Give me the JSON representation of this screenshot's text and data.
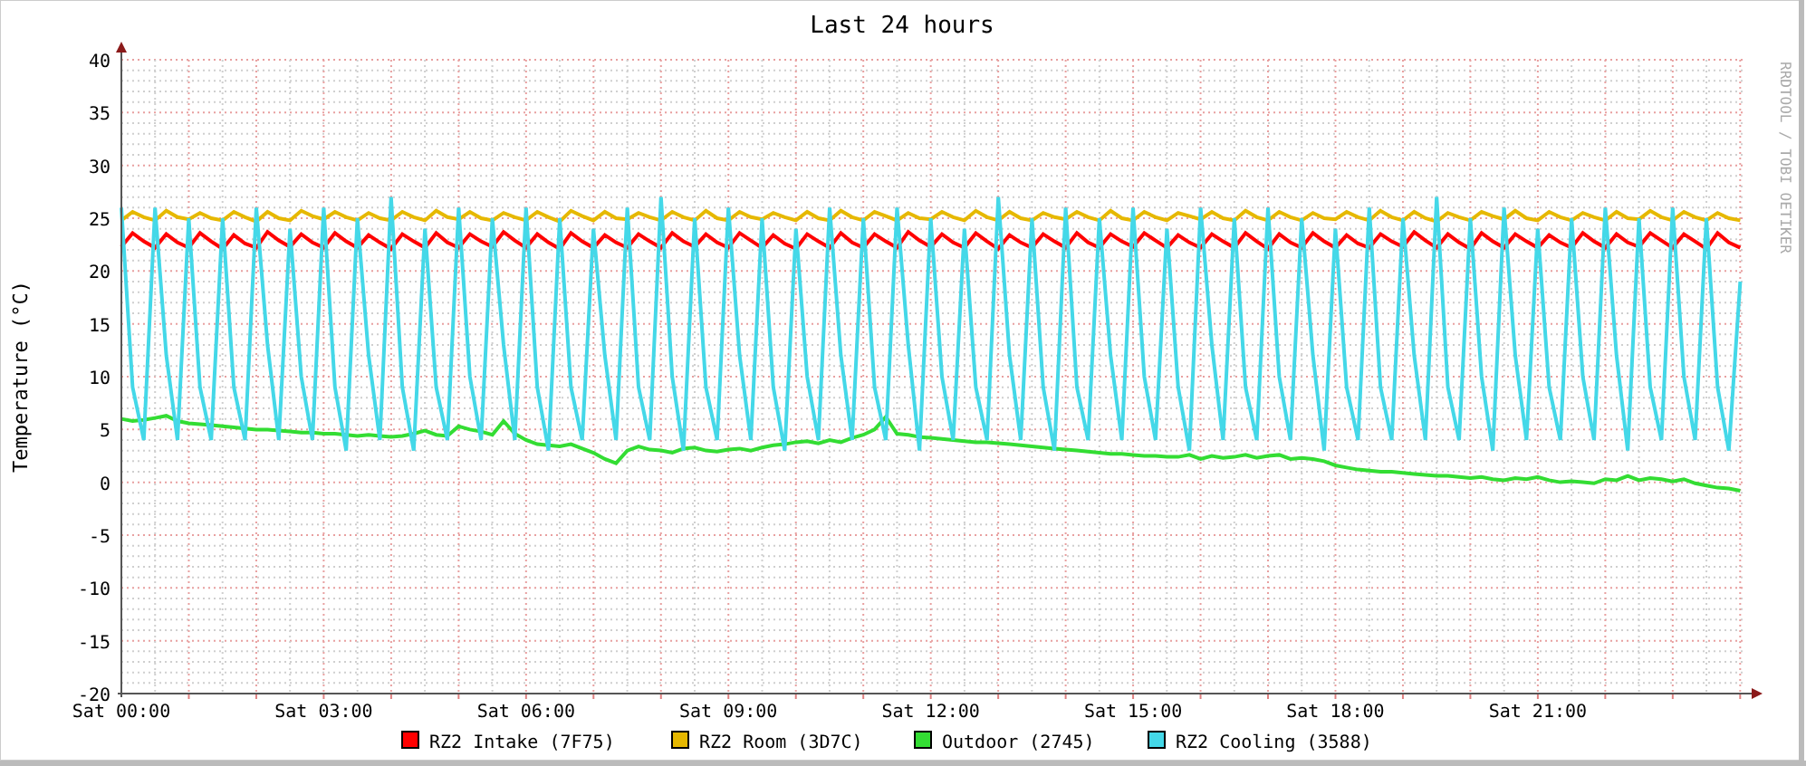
{
  "credit": "RRDTOOL / TOBI OETIKER",
  "chart_data": {
    "type": "line",
    "title": "Last 24 hours",
    "ylabel": "Temperature (°C)",
    "categories": [
      "Sat 00:00",
      null,
      null,
      null,
      null,
      null,
      null,
      null,
      null,
      null,
      null,
      null,
      null,
      null,
      null,
      null,
      null,
      null,
      "Sat 03:00",
      null,
      null,
      null,
      null,
      null,
      null,
      null,
      null,
      null,
      null,
      null,
      null,
      null,
      null,
      null,
      null,
      null,
      "Sat 06:00",
      null,
      null,
      null,
      null,
      null,
      null,
      null,
      null,
      null,
      null,
      null,
      null,
      null,
      null,
      null,
      null,
      null,
      "Sat 09:00",
      null,
      null,
      null,
      null,
      null,
      null,
      null,
      null,
      null,
      null,
      null,
      null,
      null,
      null,
      null,
      null,
      null,
      "Sat 12:00",
      null,
      null,
      null,
      null,
      null,
      null,
      null,
      null,
      null,
      null,
      null,
      null,
      null,
      null,
      null,
      null,
      null,
      "Sat 15:00",
      null,
      null,
      null,
      null,
      null,
      null,
      null,
      null,
      null,
      null,
      null,
      null,
      null,
      null,
      null,
      null,
      null,
      "Sat 18:00",
      null,
      null,
      null,
      null,
      null,
      null,
      null,
      null,
      null,
      null,
      null,
      null,
      null,
      null,
      null,
      null,
      null,
      "Sat 21:00",
      null,
      null,
      null,
      null,
      null,
      null,
      null,
      null,
      null,
      null,
      null,
      null,
      null,
      null,
      null,
      null,
      null,
      null
    ],
    "ylim": [
      -20,
      40
    ],
    "grid": true,
    "legend": "bottom",
    "yticks": [
      -20,
      -15,
      -10,
      -5,
      0,
      5,
      10,
      15,
      20,
      25,
      30,
      35,
      40
    ],
    "series": [
      {
        "name": "RZ2 Intake (7F75)",
        "color": "#ff0000",
        "values": [
          22.3,
          23.6,
          22.8,
          22.2,
          23.5,
          22.7,
          22.2,
          23.6,
          22.8,
          22.1,
          23.4,
          22.6,
          22.2,
          23.7,
          22.9,
          22.3,
          23.5,
          22.7,
          22.2,
          23.6,
          22.8,
          22.2,
          23.4,
          22.7,
          22.1,
          23.5,
          22.8,
          22.2,
          23.6,
          22.7,
          22.2,
          23.5,
          22.8,
          22.3,
          23.7,
          22.9,
          22.2,
          23.5,
          22.7,
          22.1,
          23.6,
          22.8,
          22.2,
          23.4,
          22.7,
          22.2,
          23.5,
          22.8,
          22.2,
          23.6,
          22.8,
          22.3,
          23.5,
          22.7,
          22.2,
          23.6,
          22.9,
          22.2,
          23.4,
          22.6,
          22.1,
          23.5,
          22.8,
          22.2,
          23.6,
          22.7,
          22.2,
          23.5,
          22.8,
          22.2,
          23.7,
          22.9,
          22.3,
          23.5,
          22.7,
          22.2,
          23.6,
          22.8,
          22.1,
          23.4,
          22.7,
          22.2,
          23.5,
          22.8,
          22.2,
          23.6,
          22.7,
          22.2,
          23.5,
          22.8,
          22.3,
          23.6,
          22.9,
          22.2,
          23.4,
          22.7,
          22.2,
          23.5,
          22.8,
          22.2,
          23.6,
          22.8,
          22.1,
          23.5,
          22.7,
          22.2,
          23.6,
          22.8,
          22.2,
          23.4,
          22.6,
          22.2,
          23.5,
          22.8,
          22.3,
          23.7,
          22.9,
          22.2,
          23.5,
          22.7,
          22.1,
          23.6,
          22.8,
          22.2,
          23.5,
          22.8,
          22.2,
          23.4,
          22.7,
          22.2,
          23.6,
          22.8,
          22.2,
          23.5,
          22.7,
          22.3,
          23.6,
          22.9,
          22.2,
          23.5,
          22.8,
          22.1,
          23.6,
          22.7,
          22.2
        ]
      },
      {
        "name": "RZ2 Room (3D7C)",
        "color": "#e6b800",
        "values": [
          24.8,
          25.6,
          25.1,
          24.8,
          25.7,
          25.1,
          24.9,
          25.5,
          25.0,
          24.8,
          25.6,
          25.1,
          24.7,
          25.6,
          25.0,
          24.8,
          25.7,
          25.2,
          24.9,
          25.6,
          25.1,
          24.8,
          25.5,
          25.0,
          24.8,
          25.6,
          25.1,
          24.8,
          25.7,
          25.1,
          24.9,
          25.6,
          25.0,
          24.8,
          25.5,
          25.1,
          24.8,
          25.6,
          25.1,
          24.7,
          25.7,
          25.2,
          24.8,
          25.6,
          25.0,
          24.9,
          25.5,
          25.1,
          24.8,
          25.6,
          25.1,
          24.8,
          25.7,
          25.0,
          24.8,
          25.6,
          25.1,
          24.9,
          25.5,
          25.1,
          24.8,
          25.6,
          25.0,
          24.8,
          25.7,
          25.1,
          24.8,
          25.6,
          25.2,
          24.8,
          25.5,
          25.0,
          24.9,
          25.6,
          25.1,
          24.8,
          25.7,
          25.1,
          24.8,
          25.6,
          25.0,
          24.8,
          25.5,
          25.1,
          24.9,
          25.6,
          25.1,
          24.8,
          25.7,
          25.0,
          24.8,
          25.6,
          25.1,
          24.8,
          25.5,
          25.2,
          24.9,
          25.6,
          25.0,
          24.8,
          25.7,
          25.1,
          24.8,
          25.6,
          25.1,
          24.8,
          25.5,
          25.0,
          24.9,
          25.6,
          25.1,
          24.8,
          25.7,
          25.1,
          24.8,
          25.6,
          25.0,
          24.7,
          25.5,
          25.1,
          24.8,
          25.6,
          25.2,
          24.9,
          25.7,
          25.0,
          24.8,
          25.6,
          25.1,
          24.8,
          25.5,
          25.1,
          24.8,
          25.6,
          25.0,
          24.9,
          25.7,
          25.1,
          24.8,
          25.6,
          25.1,
          24.8,
          25.5,
          25.0,
          24.8
        ]
      },
      {
        "name": "Outdoor (2745)",
        "color": "#33dd33",
        "values": [
          6.0,
          5.8,
          5.9,
          6.1,
          6.3,
          5.8,
          5.6,
          5.5,
          5.4,
          5.3,
          5.2,
          5.1,
          5.0,
          5.0,
          4.9,
          4.8,
          4.7,
          4.7,
          4.6,
          4.6,
          4.5,
          4.4,
          4.5,
          4.4,
          4.3,
          4.4,
          4.6,
          4.9,
          4.5,
          4.4,
          5.3,
          5.0,
          4.8,
          4.5,
          5.8,
          4.6,
          4.0,
          3.6,
          3.5,
          3.4,
          3.6,
          3.2,
          2.8,
          2.2,
          1.8,
          3.0,
          3.4,
          3.1,
          3.0,
          2.8,
          3.2,
          3.3,
          3.0,
          2.9,
          3.1,
          3.2,
          3.0,
          3.3,
          3.5,
          3.6,
          3.8,
          3.9,
          3.7,
          4.0,
          3.8,
          4.2,
          4.5,
          5.0,
          6.2,
          4.6,
          4.5,
          4.3,
          4.2,
          4.1,
          4.0,
          3.9,
          3.8,
          3.8,
          3.7,
          3.6,
          3.5,
          3.4,
          3.3,
          3.2,
          3.1,
          3.0,
          2.9,
          2.8,
          2.7,
          2.7,
          2.6,
          2.5,
          2.5,
          2.4,
          2.4,
          2.6,
          2.2,
          2.5,
          2.3,
          2.4,
          2.6,
          2.3,
          2.5,
          2.6,
          2.2,
          2.3,
          2.2,
          2.0,
          1.6,
          1.4,
          1.2,
          1.1,
          1.0,
          1.0,
          0.9,
          0.8,
          0.7,
          0.6,
          0.6,
          0.5,
          0.4,
          0.5,
          0.3,
          0.2,
          0.4,
          0.3,
          0.5,
          0.2,
          0.0,
          0.1,
          0.0,
          -0.1,
          0.3,
          0.2,
          0.6,
          0.2,
          0.4,
          0.3,
          0.1,
          0.3,
          -0.1,
          -0.3,
          -0.5,
          -0.6,
          -0.8
        ]
      },
      {
        "name": "RZ2 Cooling (3588)",
        "color": "#44d8e8",
        "values": [
          26,
          9,
          4,
          26,
          12,
          4,
          25,
          9,
          4,
          25,
          9,
          4,
          26,
          13,
          4,
          24,
          10,
          4,
          26,
          9,
          3,
          25,
          12,
          4,
          27,
          9,
          3,
          24,
          9,
          4,
          26,
          10,
          4,
          25,
          13,
          4,
          26,
          9,
          3,
          25,
          9,
          4,
          24,
          12,
          4,
          26,
          9,
          4,
          27,
          10,
          3,
          25,
          9,
          4,
          26,
          12,
          4,
          25,
          9,
          3,
          24,
          10,
          4,
          26,
          12,
          4,
          25,
          9,
          4,
          26,
          13,
          3,
          25,
          10,
          4,
          24,
          9,
          4,
          27,
          12,
          4,
          25,
          9,
          3,
          26,
          9,
          4,
          25,
          12,
          4,
          26,
          10,
          4,
          24,
          9,
          3,
          26,
          13,
          4,
          25,
          9,
          4,
          26,
          10,
          4,
          25,
          12,
          3,
          24,
          9,
          4,
          26,
          9,
          4,
          25,
          12,
          4,
          27,
          9,
          4,
          25,
          10,
          3,
          26,
          12,
          4,
          24,
          9,
          4,
          25,
          10,
          4,
          26,
          12,
          3,
          25,
          9,
          4,
          26,
          10,
          4,
          25,
          9,
          3,
          19
        ]
      }
    ]
  }
}
